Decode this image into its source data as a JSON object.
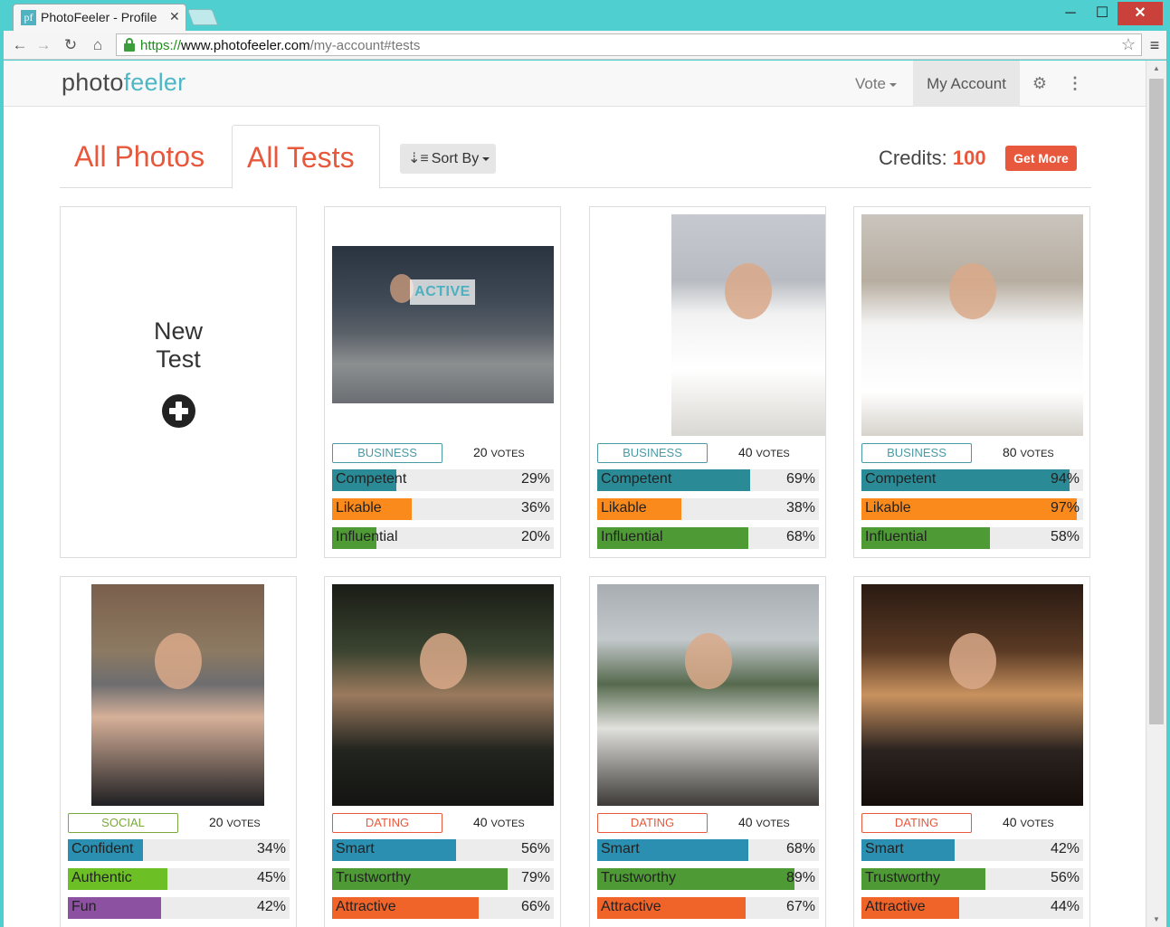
{
  "browser": {
    "tab_title": "PhotoFeeler - Profile",
    "tab_favicon": "pf",
    "url_scheme": "https://",
    "url_host": "www.photofeeler.com",
    "url_path": "/my-account#tests"
  },
  "navbar": {
    "logo_a": "photo",
    "logo_b": "feeler",
    "vote_label": "Vote",
    "account_label": "My Account"
  },
  "tabs": {
    "all_photos": "All Photos",
    "all_tests": "All Tests",
    "sort_by": "Sort By"
  },
  "credits": {
    "label": "Credits:",
    "value": "100",
    "get_more": "Get More"
  },
  "new_test": {
    "line1": "New",
    "line2": "Test"
  },
  "votes_suffix": "VOTES",
  "colors": {
    "brand": "#e8583c",
    "teal": "#4eb7c5",
    "business": "#4a9aa5",
    "social": "#7aa83a",
    "dating": "#e8583c"
  },
  "tests": [
    {
      "category": "BUSINESS",
      "category_color": "#4a9aa5",
      "votes": "20",
      "active": true,
      "active_label": "ACTIVE",
      "photo": "man-on-bench-with-laptop",
      "metrics": [
        {
          "label": "Competent",
          "pct": 29,
          "pct_label": "29%",
          "color": "#2a8a96"
        },
        {
          "label": "Likable",
          "pct": 36,
          "pct_label": "36%",
          "color": "#fb8a1c"
        },
        {
          "label": "Influential",
          "pct": 20,
          "pct_label": "20%",
          "color": "#4e9a35"
        }
      ]
    },
    {
      "category": "BUSINESS",
      "category_color": "#4a9aa5",
      "votes": "40",
      "active": false,
      "photo": "man-in-white-shirt-tie",
      "metrics": [
        {
          "label": "Competent",
          "pct": 69,
          "pct_label": "69%",
          "color": "#2a8a96"
        },
        {
          "label": "Likable",
          "pct": 38,
          "pct_label": "38%",
          "color": "#fb8a1c"
        },
        {
          "label": "Influential",
          "pct": 68,
          "pct_label": "68%",
          "color": "#4e9a35"
        }
      ]
    },
    {
      "category": "BUSINESS",
      "category_color": "#4a9aa5",
      "votes": "80",
      "active": false,
      "photo": "man-in-white-shirt-tie-closeup",
      "metrics": [
        {
          "label": "Competent",
          "pct": 94,
          "pct_label": "94%",
          "color": "#2a8a96"
        },
        {
          "label": "Likable",
          "pct": 97,
          "pct_label": "97%",
          "color": "#fb8a1c"
        },
        {
          "label": "Influential",
          "pct": 58,
          "pct_label": "58%",
          "color": "#4e9a35"
        }
      ]
    },
    {
      "category": "SOCIAL",
      "category_color": "#7aa83a",
      "votes": "20",
      "active": false,
      "photo": "man-in-beanie-outdoors",
      "metrics": [
        {
          "label": "Confident",
          "pct": 34,
          "pct_label": "34%",
          "color": "#2a8fb0"
        },
        {
          "label": "Authentic",
          "pct": 45,
          "pct_label": "45%",
          "color": "#6cbf24"
        },
        {
          "label": "Fun",
          "pct": 42,
          "pct_label": "42%",
          "color": "#8c51a0"
        }
      ]
    },
    {
      "category": "DATING",
      "category_color": "#e8583c",
      "votes": "40",
      "active": false,
      "photo": "man-at-night-party",
      "metrics": [
        {
          "label": "Smart",
          "pct": 56,
          "pct_label": "56%",
          "color": "#2a8fb0"
        },
        {
          "label": "Trustworthy",
          "pct": 79,
          "pct_label": "79%",
          "color": "#4e9a35"
        },
        {
          "label": "Attractive",
          "pct": 66,
          "pct_label": "66%",
          "color": "#f0642a"
        }
      ]
    },
    {
      "category": "DATING",
      "category_color": "#e8583c",
      "votes": "40",
      "active": false,
      "photo": "man-standing-garden",
      "metrics": [
        {
          "label": "Smart",
          "pct": 68,
          "pct_label": "68%",
          "color": "#2a8fb0"
        },
        {
          "label": "Trustworthy",
          "pct": 89,
          "pct_label": "89%",
          "color": "#4e9a35"
        },
        {
          "label": "Attractive",
          "pct": 67,
          "pct_label": "67%",
          "color": "#f0642a"
        }
      ]
    },
    {
      "category": "DATING",
      "category_color": "#e8583c",
      "votes": "40",
      "active": false,
      "photo": "man-at-restaurant-table",
      "metrics": [
        {
          "label": "Smart",
          "pct": 42,
          "pct_label": "42%",
          "color": "#2a8fb0"
        },
        {
          "label": "Trustworthy",
          "pct": 56,
          "pct_label": "56%",
          "color": "#4e9a35"
        },
        {
          "label": "Attractive",
          "pct": 44,
          "pct_label": "44%",
          "color": "#f0642a"
        }
      ]
    }
  ]
}
